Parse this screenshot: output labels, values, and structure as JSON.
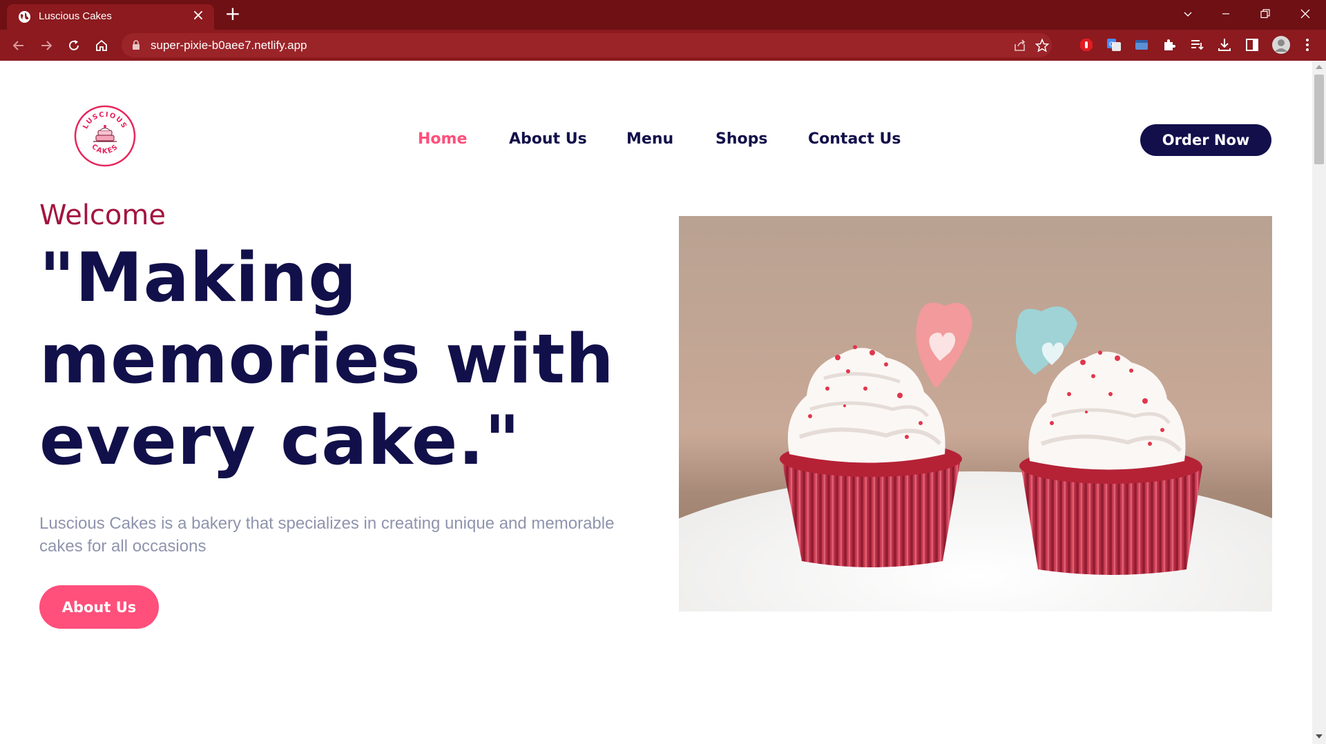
{
  "browser": {
    "tab_title": "Luscious Cakes",
    "url": "super-pixie-b0aee7.netlify.app"
  },
  "site": {
    "logo_text_top": "LUSCIOUS",
    "logo_text_bottom": "CAKES",
    "nav": [
      {
        "label": "Home",
        "active": true
      },
      {
        "label": "About Us",
        "active": false
      },
      {
        "label": "Menu",
        "active": false
      },
      {
        "label": "Shops",
        "active": false
      },
      {
        "label": "Contact Us",
        "active": false
      }
    ],
    "order_button": "Order Now"
  },
  "hero": {
    "welcome": "Welcome",
    "headline_line1": "\"Making",
    "headline_line2": "memories with",
    "headline_line3": "every cake.\"",
    "description": "Luscious Cakes is a bakery that specializes in creating unique and memorable cakes for all occasions",
    "button": "About Us"
  },
  "colors": {
    "accent_pink": "#ff4f7b",
    "navy": "#12104a",
    "welcome_red": "#a3143f",
    "chrome_dark": "#6e1014",
    "chrome": "#8c1a1f"
  },
  "icons": [
    "globe-icon",
    "close-icon",
    "plus-icon",
    "back-icon",
    "forward-icon",
    "reload-icon",
    "home-icon",
    "lock-icon",
    "share-icon",
    "star-icon",
    "extensions-icon",
    "download-icon",
    "sidebar-icon",
    "menu-icon"
  ]
}
